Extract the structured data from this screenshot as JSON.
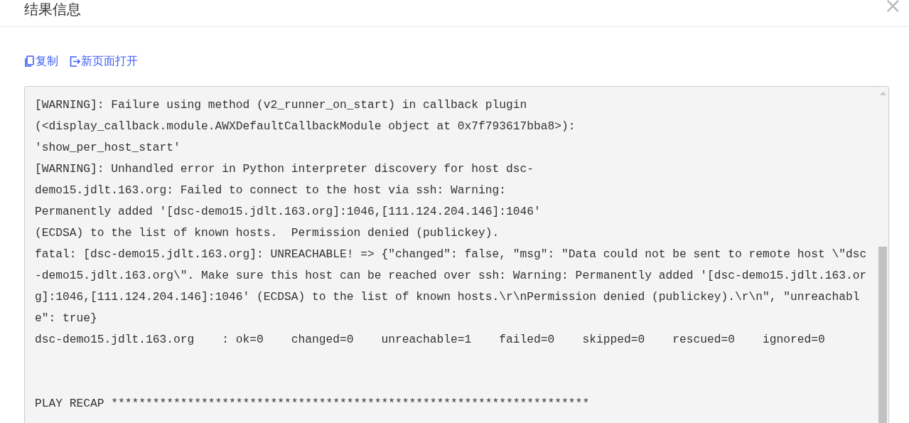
{
  "dialog": {
    "title": "结果信息",
    "close": "×"
  },
  "actions": [
    {
      "kind": "copy",
      "label": "复制"
    },
    {
      "kind": "open",
      "label": "新页面打开"
    }
  ],
  "log_lines": [
    {
      "kind": "line",
      "text": "[WARNING]: Failure using method (v2_runner_on_start) in callback plugin"
    },
    {
      "kind": "line",
      "text": "(<display_callback.module.AWXDefaultCallbackModule object at 0x7f793617bba8>):"
    },
    {
      "kind": "line",
      "text": "'show_per_host_start'"
    },
    {
      "kind": "line",
      "text": "[WARNING]: Unhandled error in Python interpreter discovery for host dsc-"
    },
    {
      "kind": "line",
      "text": "demo15.jdlt.163.org: Failed to connect to the host via ssh: Warning:"
    },
    {
      "kind": "line",
      "text": "Permanently added '[dsc-demo15.jdlt.163.org]:1046,[111.124.204.146]:1046'"
    },
    {
      "kind": "line",
      "text": "(ECDSA) to the list of known hosts.  Permission denied (publickey)."
    },
    {
      "kind": "line",
      "text": "fatal: [dsc-demo15.jdlt.163.org]: UNREACHABLE! => {\"changed\": false, \"msg\": \"Data could not be sent to remote host \\\"dsc"
    },
    {
      "kind": "line",
      "text": "-demo15.jdlt.163.org\\\". Make sure this host can be reached over ssh: Warning: Permanently added '[dsc-demo15.jdlt.163.or"
    },
    {
      "kind": "line",
      "text": "g]:1046,[111.124.204.146]:1046' (ECDSA) to the list of known hosts.\\r\\nPermission denied (publickey).\\r\\n\", \"unreachabl"
    },
    {
      "kind": "line",
      "text": "e\": true}"
    },
    {
      "kind": "line",
      "text": "dsc-demo15.jdlt.163.org    : ok=0    changed=0    unreachable=1    failed=0    skipped=0    rescued=0    ignored=0"
    },
    {
      "kind": "section",
      "text": "PLAY RECAP *********************************************************************"
    }
  ]
}
